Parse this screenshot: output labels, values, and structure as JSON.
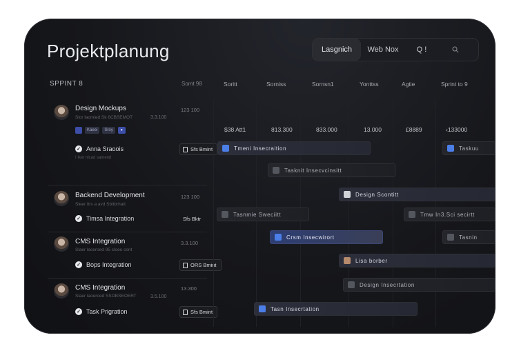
{
  "app": {
    "title": "Projektplanung"
  },
  "toolbar": {
    "items": [
      "Lasgnich",
      "Web Nox",
      "Q !"
    ]
  },
  "header": {
    "sprint": "SPPINT 8",
    "left_cell": "Somt 98",
    "columns": [
      "Soritt",
      "Sorniss",
      "Sornsn1",
      "Yonttss",
      "Agtie",
      "Sprint to 9"
    ]
  },
  "values": [
    "$38 Att1",
    "813.300",
    "833.000",
    "13.000",
    "£8889",
    "‹133000"
  ],
  "tasks": [
    {
      "title": "Design Mockups",
      "subtitle": "Slor laomied Sk 6CBSEMOT",
      "meta": "3.3.100",
      "num": "123 100",
      "tags": [
        "",
        "Kaeei",
        "Sroy",
        "●"
      ],
      "assignee": "Anna Sraoois",
      "note": "I Iker nicad samend",
      "badge": "Sfs Bmint"
    },
    {
      "title": "Backend Development",
      "subtitle": "Sleer lIrs a avd Sbitbrhatt",
      "num": "123 100",
      "assignee": "Timsa Integration",
      "badge": "Sfs Bktr"
    },
    {
      "title": "CMS Integration",
      "subtitle": "Slaer laceroed 95 cloeo corit",
      "num": "3.3.100",
      "assignee": "Bops Integration",
      "badge": "ORS Bmint"
    },
    {
      "title": "CMS Integration",
      "subtitle": "Slaer laoeroed SSOBSEOERT",
      "meta": "3.5.100",
      "num": "13.300",
      "assignee": "Task Prigration",
      "badge": "Sfs Bmint"
    }
  ],
  "bars": [
    {
      "label": "Tmeni Insecraition",
      "icon": "blue"
    },
    {
      "label": "Tasknit Insecvcinsitt",
      "icon": "grey"
    },
    {
      "label": "Design Scontitt",
      "icon": "light"
    },
    {
      "label": "Tasnmie Sweciitt",
      "icon": "grey"
    },
    {
      "label": "Tmw In3.Sci secirtt",
      "icon": "grey"
    },
    {
      "label": "Crsm Insecwirort",
      "icon": "blue"
    },
    {
      "label": "Tasnin",
      "icon": "grey"
    },
    {
      "label": "Lisa borber",
      "icon": "brown"
    },
    {
      "label": "Design Insecrtation",
      "icon": "grey"
    },
    {
      "label": "Tasn Insecrtation",
      "icon": "blue"
    },
    {
      "label": "Taskuu",
      "icon": "blue"
    }
  ],
  "colors": {
    "accent": "#4c7ee8",
    "background": "#16171b"
  }
}
